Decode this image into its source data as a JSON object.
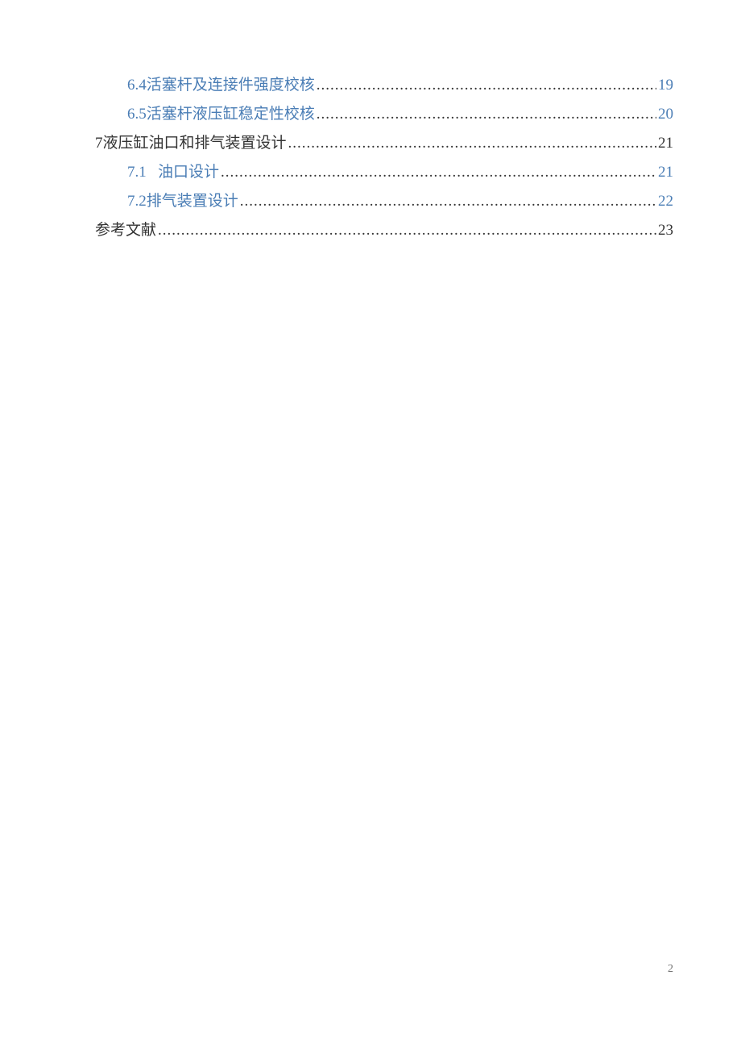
{
  "toc": {
    "e0": {
      "num": "6.4",
      "title": "活塞杆及连接件强度校核",
      "page": "19"
    },
    "e1": {
      "num": "6.5",
      "title": "活塞杆液压缸稳定性校核",
      "page": "20"
    },
    "e2": {
      "num": "7",
      "title": "液压缸油口和排气装置设计",
      "page": "21"
    },
    "e3": {
      "num": "7.1",
      "title": "油口设计",
      "page": "21"
    },
    "e4": {
      "num": "7.2",
      "title": "排气装置设计",
      "page": "22"
    },
    "e5": {
      "title": "参考文献",
      "page": "23"
    }
  },
  "footer": {
    "page_number": "2"
  }
}
